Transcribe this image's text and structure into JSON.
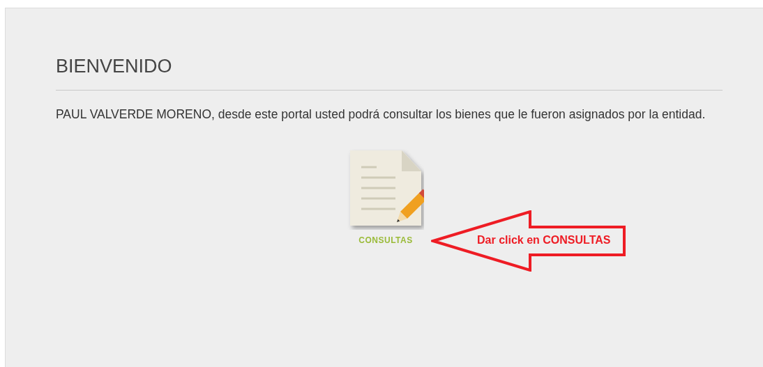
{
  "heading": "BIENVENIDO",
  "message": "PAUL VALVERDE MORENO, desde este portal usted podrá consultar los bienes que le fueron asignados por la entidad.",
  "shortcut": {
    "label": "CONSULTAS"
  },
  "annotation": {
    "text": "Dar click en CONSULTAS"
  }
}
